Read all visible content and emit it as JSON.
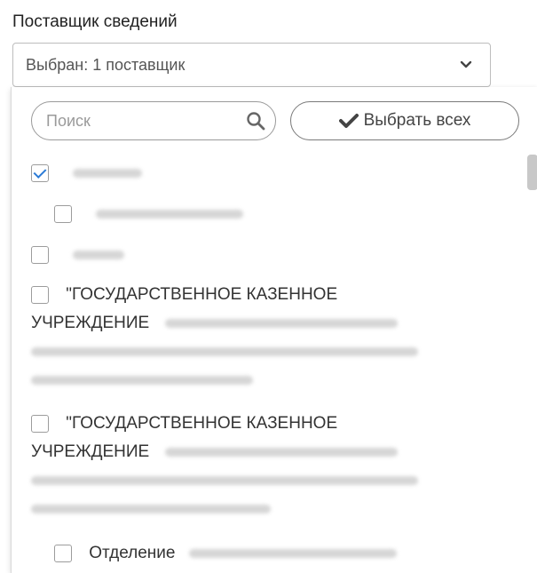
{
  "field": {
    "label": "Поставщик сведений",
    "selected_value": "Выбран: 1 поставщик"
  },
  "dropdown": {
    "search_placeholder": "Поиск",
    "select_all_label": "Выбрать всех",
    "items": [
      {
        "prefix": "",
        "checked": true
      },
      {
        "prefix": "",
        "checked": false
      },
      {
        "prefix": "",
        "checked": false
      },
      {
        "line1": "\"ГОСУДАРСТВЕННОЕ КАЗЕННОЕ",
        "line2": "УЧРЕЖДЕНИЕ",
        "checked": false
      },
      {
        "line1": "\"ГОСУДАРСТВЕННОЕ КАЗЕННОЕ",
        "line2": "УЧРЕЖДЕНИЕ",
        "checked": false
      },
      {
        "prefix": "Отделение",
        "checked": false
      }
    ]
  },
  "icons": [
    "chevron-down-icon",
    "search-icon",
    "checkmark-icon"
  ],
  "colors": {
    "accent": "#2b7bd6",
    "border": "#bdbdbd"
  }
}
